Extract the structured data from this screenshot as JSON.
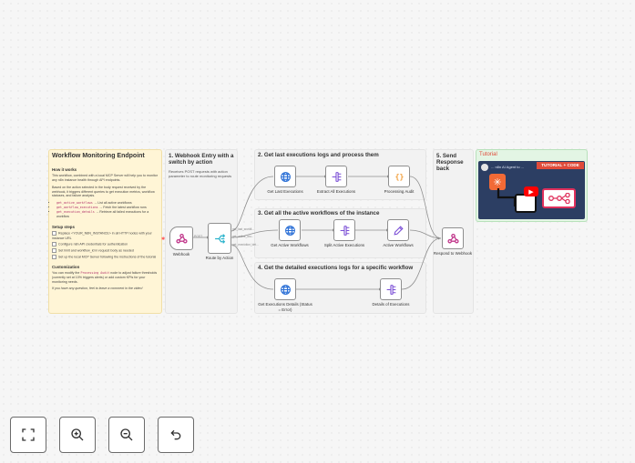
{
  "main_note": {
    "title": "Workflow Monitoring Endpoint",
    "how_heading": "How it works",
    "how_p1": "This workflow, combined with a local MCP Server will help you to monitor any n8n instance health through API endpoints.",
    "how_p2": "Based on the action selected in the body request received by the webhook, it triggers different queries to get execution metrics, workflow statuses, and failure analysis.",
    "actions": [
      {
        "code": "get_active_workflows",
        "text": "→ List all active workflows"
      },
      {
        "code": "get_workflow_executions",
        "text": "→ Fetch the latest workflow runs"
      },
      {
        "code": "get_execution_details",
        "text": "→ Retrieve all failed executions for a workflow"
      }
    ],
    "setup_heading": "Setup steps",
    "setup_items": [
      "Replace <YOUR_N8N_INSTANCE> in all HTTP nodes with your instance URL",
      "Configure n8n API credentials for authentication",
      "Set limit and workflow_id in request body as needed",
      "Set up the local MCP Server following the instructions of the tutorial"
    ],
    "custom_heading": "Customization",
    "custom_p1_a": "You can modify the",
    "custom_p1_code": "Processing Audit",
    "custom_p1_b": "node to adjust failure thresholds (currently set at 10% triggers alerts) or add custom KPIs for your monitoring needs.",
    "custom_p2": "If you have any question, feel to leave a comment in the video!"
  },
  "sticky_1": {
    "title": "1. Webhook Entry with a switch by action",
    "desc": "Receives POST requests with action parameter to route monitoring requests"
  },
  "sticky_2": {
    "title": "2. Get last executions logs and process them"
  },
  "sticky_3": {
    "title": "3. Get all the active workflows of the instance"
  },
  "sticky_4": {
    "title": "4. Get the detailed executions logs for a specific workflow"
  },
  "sticky_5": {
    "title": "5. Send Response back"
  },
  "tutorial": {
    "title": "Tutorial",
    "banner": "TUTORIAL + CODE",
    "video_caption": "... n8n AI Agent to ..."
  },
  "nodes": {
    "webhook": "Webhook",
    "route": "Route by Action",
    "get_last": "Get Last Executions",
    "extract_all": "Extract All Executions",
    "processing": "Processing Audit",
    "get_active": "Get Active Workflows",
    "split_active": "Split Active Executions",
    "active_wf": "Active Workflows",
    "get_details": "Get Executions Details (Status = Error)",
    "details": "Details of Executions",
    "respond": "Respond to Webhook"
  },
  "edge_labels": {
    "webhook_out": "POST",
    "route_out_1": "get_last_workfl...",
    "route_out_2": "get_active_wo...",
    "route_out_3": "get_execution_det..."
  },
  "colors": {
    "sticky_yellow": "#fff5d6",
    "sticky_gray": "#f2f2f2",
    "sticky_green": "#e3f5e4",
    "http_blue": "#2a6fd6",
    "code_orange": "#f29f3b",
    "split_purple": "#7b4fd6",
    "webhook_pink": "#c1378b",
    "tutorial_red": "#e04b3a"
  },
  "icons": {
    "zoom_fit": "fullscreen-icon",
    "zoom_in": "zoom-in-icon",
    "zoom_out": "zoom-out-icon",
    "reset": "undo-icon"
  }
}
